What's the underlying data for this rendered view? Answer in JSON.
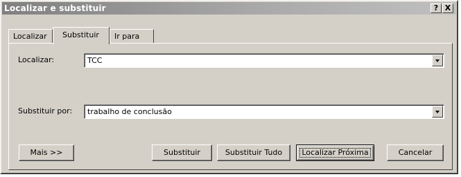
{
  "window": {
    "title": "Localizar e substituir",
    "help_label": "?",
    "close_label": "X"
  },
  "tabs": [
    {
      "label": "Localizar",
      "active": false
    },
    {
      "label": "Substituir",
      "active": true
    },
    {
      "label": "Ir para",
      "active": false
    }
  ],
  "find": {
    "label": "Localizar:",
    "value": "TCC"
  },
  "replace": {
    "label": "Substituir por:",
    "value": "trabalho de conclusão"
  },
  "buttons": {
    "more": "Mais >>",
    "replace": "Substituir",
    "replace_all": "Substituir Tudo",
    "find_next": "Localizar Próxima",
    "cancel": "Cancelar"
  }
}
